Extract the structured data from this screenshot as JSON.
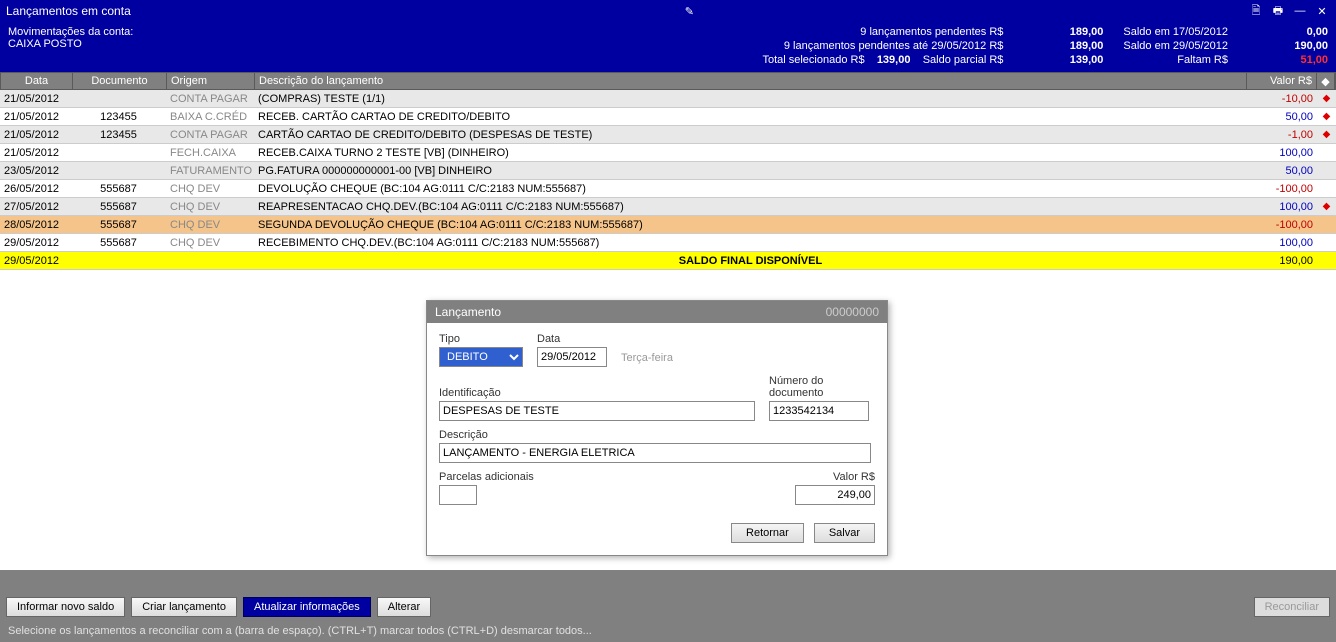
{
  "title": "Lançamentos em conta",
  "summary": {
    "movLabel": "Movimentações da conta:",
    "account": "CAIXA POSTO",
    "rows": [
      {
        "l1": "9 lançamentos pendentes R$",
        "v1": "189,00",
        "l2": "Saldo em 17/05/2012",
        "v2": "0,00"
      },
      {
        "l1": "9 lançamentos pendentes até 29/05/2012 R$",
        "v1": "189,00",
        "l2": "Saldo em 29/05/2012",
        "v2": "190,00"
      },
      {
        "l1": "Total selecionado R$",
        "v1": "139,00",
        "l2a": "Saldo parcial R$",
        "v2a": "139,00",
        "l2": "Faltam R$",
        "v2": "51,00",
        "v2class": "red-val"
      }
    ]
  },
  "headers": {
    "data": "Data",
    "doc": "Documento",
    "orig": "Origem",
    "desc": "Descrição do lançamento",
    "valor": "Valor R$"
  },
  "rows": [
    {
      "data": "21/05/2012",
      "doc": "",
      "orig": "CONTA PAGAR",
      "desc": "(COMPRAS) TESTE (1/1)",
      "valor": "-10,00",
      "cls": "val-neg",
      "mark": true,
      "rowcls": "row-alt"
    },
    {
      "data": "21/05/2012",
      "doc": "123455",
      "orig": "BAIXA C.CRÉD",
      "desc": "RECEB. CARTÃO CARTAO DE CREDITO/DEBITO",
      "valor": "50,00",
      "cls": "val-pos",
      "mark": true,
      "rowcls": ""
    },
    {
      "data": "21/05/2012",
      "doc": "123455",
      "orig": "CONTA PAGAR",
      "desc": "CARTÃO CARTAO DE CREDITO/DEBITO (DESPESAS DE TESTE)",
      "valor": "-1,00",
      "cls": "val-neg",
      "mark": true,
      "rowcls": "row-alt"
    },
    {
      "data": "21/05/2012",
      "doc": "",
      "orig": "FECH.CAIXA",
      "desc": "RECEB.CAIXA TURNO 2 TESTE [VB] (DINHEIRO)",
      "valor": "100,00",
      "cls": "val-pos",
      "mark": false,
      "rowcls": ""
    },
    {
      "data": "23/05/2012",
      "doc": "",
      "orig": "FATURAMENTO",
      "desc": "PG.FATURA 000000000001-00 [VB] DINHEIRO",
      "valor": "50,00",
      "cls": "val-pos",
      "mark": false,
      "rowcls": "row-alt"
    },
    {
      "data": "26/05/2012",
      "doc": "555687",
      "orig": "CHQ DEV",
      "desc": "DEVOLUÇÃO CHEQUE (BC:104 AG:0111 C/C:2183 NUM:555687)",
      "valor": "-100,00",
      "cls": "val-neg",
      "mark": false,
      "rowcls": ""
    },
    {
      "data": "27/05/2012",
      "doc": "555687",
      "orig": "CHQ DEV",
      "desc": "REAPRESENTACAO CHQ.DEV.(BC:104 AG:0111 C/C:2183 NUM:555687)",
      "valor": "100,00",
      "cls": "val-pos",
      "mark": true,
      "rowcls": "row-alt"
    },
    {
      "data": "28/05/2012",
      "doc": "555687",
      "orig": "CHQ DEV",
      "desc": "SEGUNDA DEVOLUÇÃO CHEQUE (BC:104 AG:0111 C/C:2183 NUM:555687)",
      "valor": "-100,00",
      "cls": "val-neg",
      "mark": false,
      "rowcls": "row-sel"
    },
    {
      "data": "29/05/2012",
      "doc": "555687",
      "orig": "CHQ DEV",
      "desc": "RECEBIMENTO CHQ.DEV.(BC:104 AG:0111 C/C:2183 NUM:555687)",
      "valor": "100,00",
      "cls": "val-pos",
      "mark": false,
      "rowcls": ""
    }
  ],
  "finalRow": {
    "data": "29/05/2012",
    "desc": "SALDO FINAL DISPONÍVEL",
    "valor": "190,00"
  },
  "dialog": {
    "title": "Lançamento",
    "docnum": "00000000",
    "labels": {
      "tipo": "Tipo",
      "data": "Data",
      "ident": "Identificação",
      "numdoc": "Número do documento",
      "desc": "Descrição",
      "parc": "Parcelas adicionais",
      "valor": "Valor R$"
    },
    "values": {
      "tipo": "DEBITO",
      "data": "29/05/2012",
      "weekday": "Terça-feira",
      "ident": "DESPESAS DE TESTE",
      "numdoc": "1233542134",
      "desc": "LANÇAMENTO - ENERGIA ELETRICA",
      "parc": "",
      "valor": "249,00"
    },
    "buttons": {
      "retornar": "Retornar",
      "salvar": "Salvar"
    }
  },
  "toolbar": {
    "novo": "Informar novo saldo",
    "criar": "Criar lançamento",
    "atual": "Atualizar informações",
    "alterar": "Alterar",
    "reconc": "Reconciliar"
  },
  "status": "Selecione os lançamentos a reconciliar com a (barra de espaço). (CTRL+T) marcar todos   (CTRL+D) desmarcar todos..."
}
